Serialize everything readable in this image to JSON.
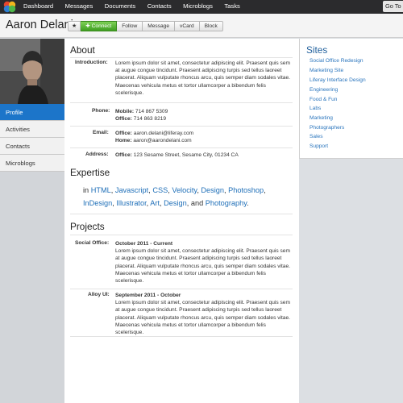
{
  "dock": {
    "nav": [
      "Dashboard",
      "Messages",
      "Documents",
      "Contacts",
      "Microblogs",
      "Tasks"
    ],
    "goto_label": "Go To"
  },
  "profile": {
    "name": "Aaron Delani",
    "actions": [
      "★",
      "Connect",
      "Follow",
      "Message",
      "vCard",
      "Block"
    ]
  },
  "sidebar": {
    "items": [
      "Profile",
      "Activities",
      "Contacts",
      "Microblogs"
    ],
    "active": "Profile"
  },
  "about": {
    "title": "About",
    "introduction_label": "Introduction:",
    "introduction": "Lorem ipsum dolor sit amet, consectetur adipiscing elit. Praesent quis sem at augue congue tincidunt. Praesent adipiscing turpis sed tellus laoreet placerat. Aliquam vulputate rhoncus arcu, quis semper diam sodales vitae. Maecenas vehicula metus et tortor ullamcorper a bibendum felis scelerisque.",
    "phone_label": "Phone:",
    "phone": [
      {
        "type": "Mobile:",
        "value": "714 867 5309"
      },
      {
        "type": "Office:",
        "value": "714 863 8219"
      }
    ],
    "email_label": "Email:",
    "email": [
      {
        "type": "Office:",
        "value": "aaron.delani@liferay.com"
      },
      {
        "type": "Home:",
        "value": "aaron@aarondelani.com"
      }
    ],
    "address_label": "Address:",
    "address": {
      "type": "Office:",
      "value": "123 Sesame Street, Sesame City, 01234 CA"
    }
  },
  "expertise": {
    "title": "Expertise",
    "prefix": "in",
    "skills": [
      "HTML",
      "Javascript",
      "CSS",
      "Velocity",
      "Design",
      "Photoshop",
      "InDesign",
      "Illustrator",
      "Art",
      "Design",
      "Photography"
    ],
    "conjunction": "and"
  },
  "projects": {
    "title": "Projects",
    "items": [
      {
        "label": "Social Office:",
        "period": "October 2011 - Current",
        "description": "Lorem ipsum dolor sit amet, consectetur adipiscing elit. Praesent quis sem at augue congue tincidunt. Praesent adipiscing turpis sed tellus laoreet placerat. Aliquam vulputate rhoncus arcu, quis semper diam sodales vitae. Maecenas vehicula metus et tortor ullamcorper a bibendum felis scelerisque."
      },
      {
        "label": "Alloy UI:",
        "period": "September 2011 - October",
        "description": "Lorem ipsum dolor sit amet, consectetur adipiscing elit. Praesent quis sem at augue congue tincidunt. Praesent adipiscing turpis sed tellus laoreet placerat. Aliquam vulputate rhoncus arcu, quis semper diam sodales vitae. Maecenas vehicula metus et tortor ullamcorper a bibendum felis scelerisque."
      }
    ]
  },
  "sites": {
    "title": "Sites",
    "items": [
      "Social Office Redesign",
      "Marketing Site",
      "Liferay Interface Design",
      "Engineering",
      "Food & Fun",
      "Labs",
      "Marketing",
      "Photographers",
      "Sales",
      "Support"
    ]
  },
  "colors": {
    "dock_bg": "#2b2b2d",
    "active_nav": "#1c75c9",
    "connect_green": "#4cae2a",
    "link_blue": "#1f6fb8"
  }
}
